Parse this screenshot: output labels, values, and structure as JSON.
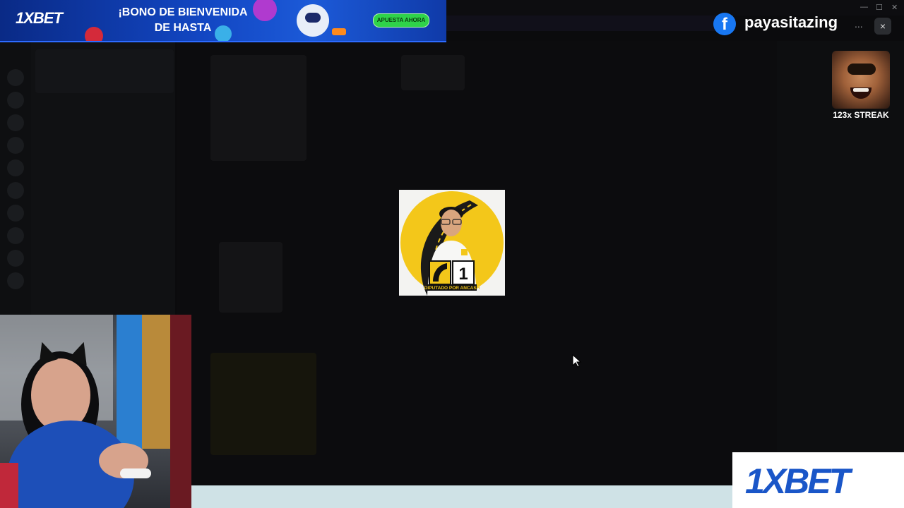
{
  "ad_top": {
    "brand": "1XBET",
    "headline_line1": "¡BONO DE BIENVENIDA",
    "headline_line2": "DE HASTA",
    "cta": "APUESTA AHORA"
  },
  "facebook_badge": {
    "username": "payasitazing",
    "more": "..."
  },
  "close_label": "×",
  "streak": {
    "label": "123x STREAK"
  },
  "center_image": {
    "ballot_number": "1",
    "caption": "DIPUTADO POR ANCASH"
  },
  "ad_bottom": {
    "brand": "1XBET"
  },
  "window_controls": {
    "minimize": "—",
    "maximize": "☐",
    "close": "✕"
  },
  "colors": {
    "brand_blue": "#1a56c8",
    "facebook_blue": "#1877f2",
    "cta_green": "#2fd34a",
    "poster_yellow": "#f3c71a"
  }
}
